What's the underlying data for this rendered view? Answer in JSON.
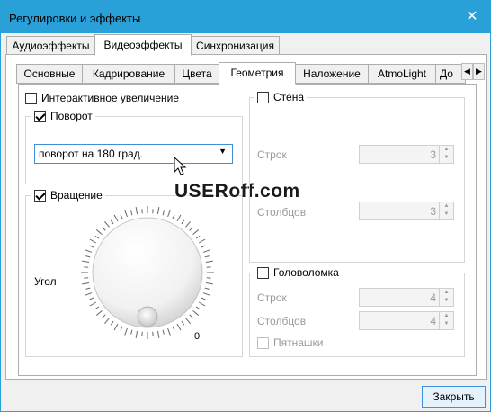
{
  "window": {
    "title": "Регулировки и эффекты",
    "close_glyph": "✕"
  },
  "top_tabs": [
    "Аудиоэффекты",
    "Видеоэффекты",
    "Синхронизация"
  ],
  "sub_tabs": [
    "Основные",
    "Кадрирование",
    "Цвета",
    "Геометрия",
    "Наложение",
    "AtmoLight",
    "До"
  ],
  "scroll_left": "◀",
  "scroll_right": "▶",
  "geometry": {
    "interactive_zoom": {
      "label": "Интерактивное увеличение",
      "checked": false
    },
    "rotate": {
      "label": "Поворот",
      "checked": true,
      "selected": "поворот на 180 град."
    },
    "rotation": {
      "label": "Вращение",
      "checked": true,
      "angle_label": "Угол",
      "angle_value": "0"
    },
    "wall": {
      "label": "Стена",
      "checked": false,
      "rows_label": "Строк",
      "rows_value": "3",
      "cols_label": "Столбцов",
      "cols_value": "3"
    },
    "puzzle": {
      "label": "Головоломка",
      "checked": false,
      "rows_label": "Строк",
      "rows_value": "4",
      "cols_label": "Столбцов",
      "cols_value": "4",
      "blackslot_label": "Пятнашки"
    }
  },
  "watermark": {
    "part1": "USER",
    "part2": "off",
    "part3": ".com"
  },
  "footer": {
    "close_label": "Закрыть"
  }
}
